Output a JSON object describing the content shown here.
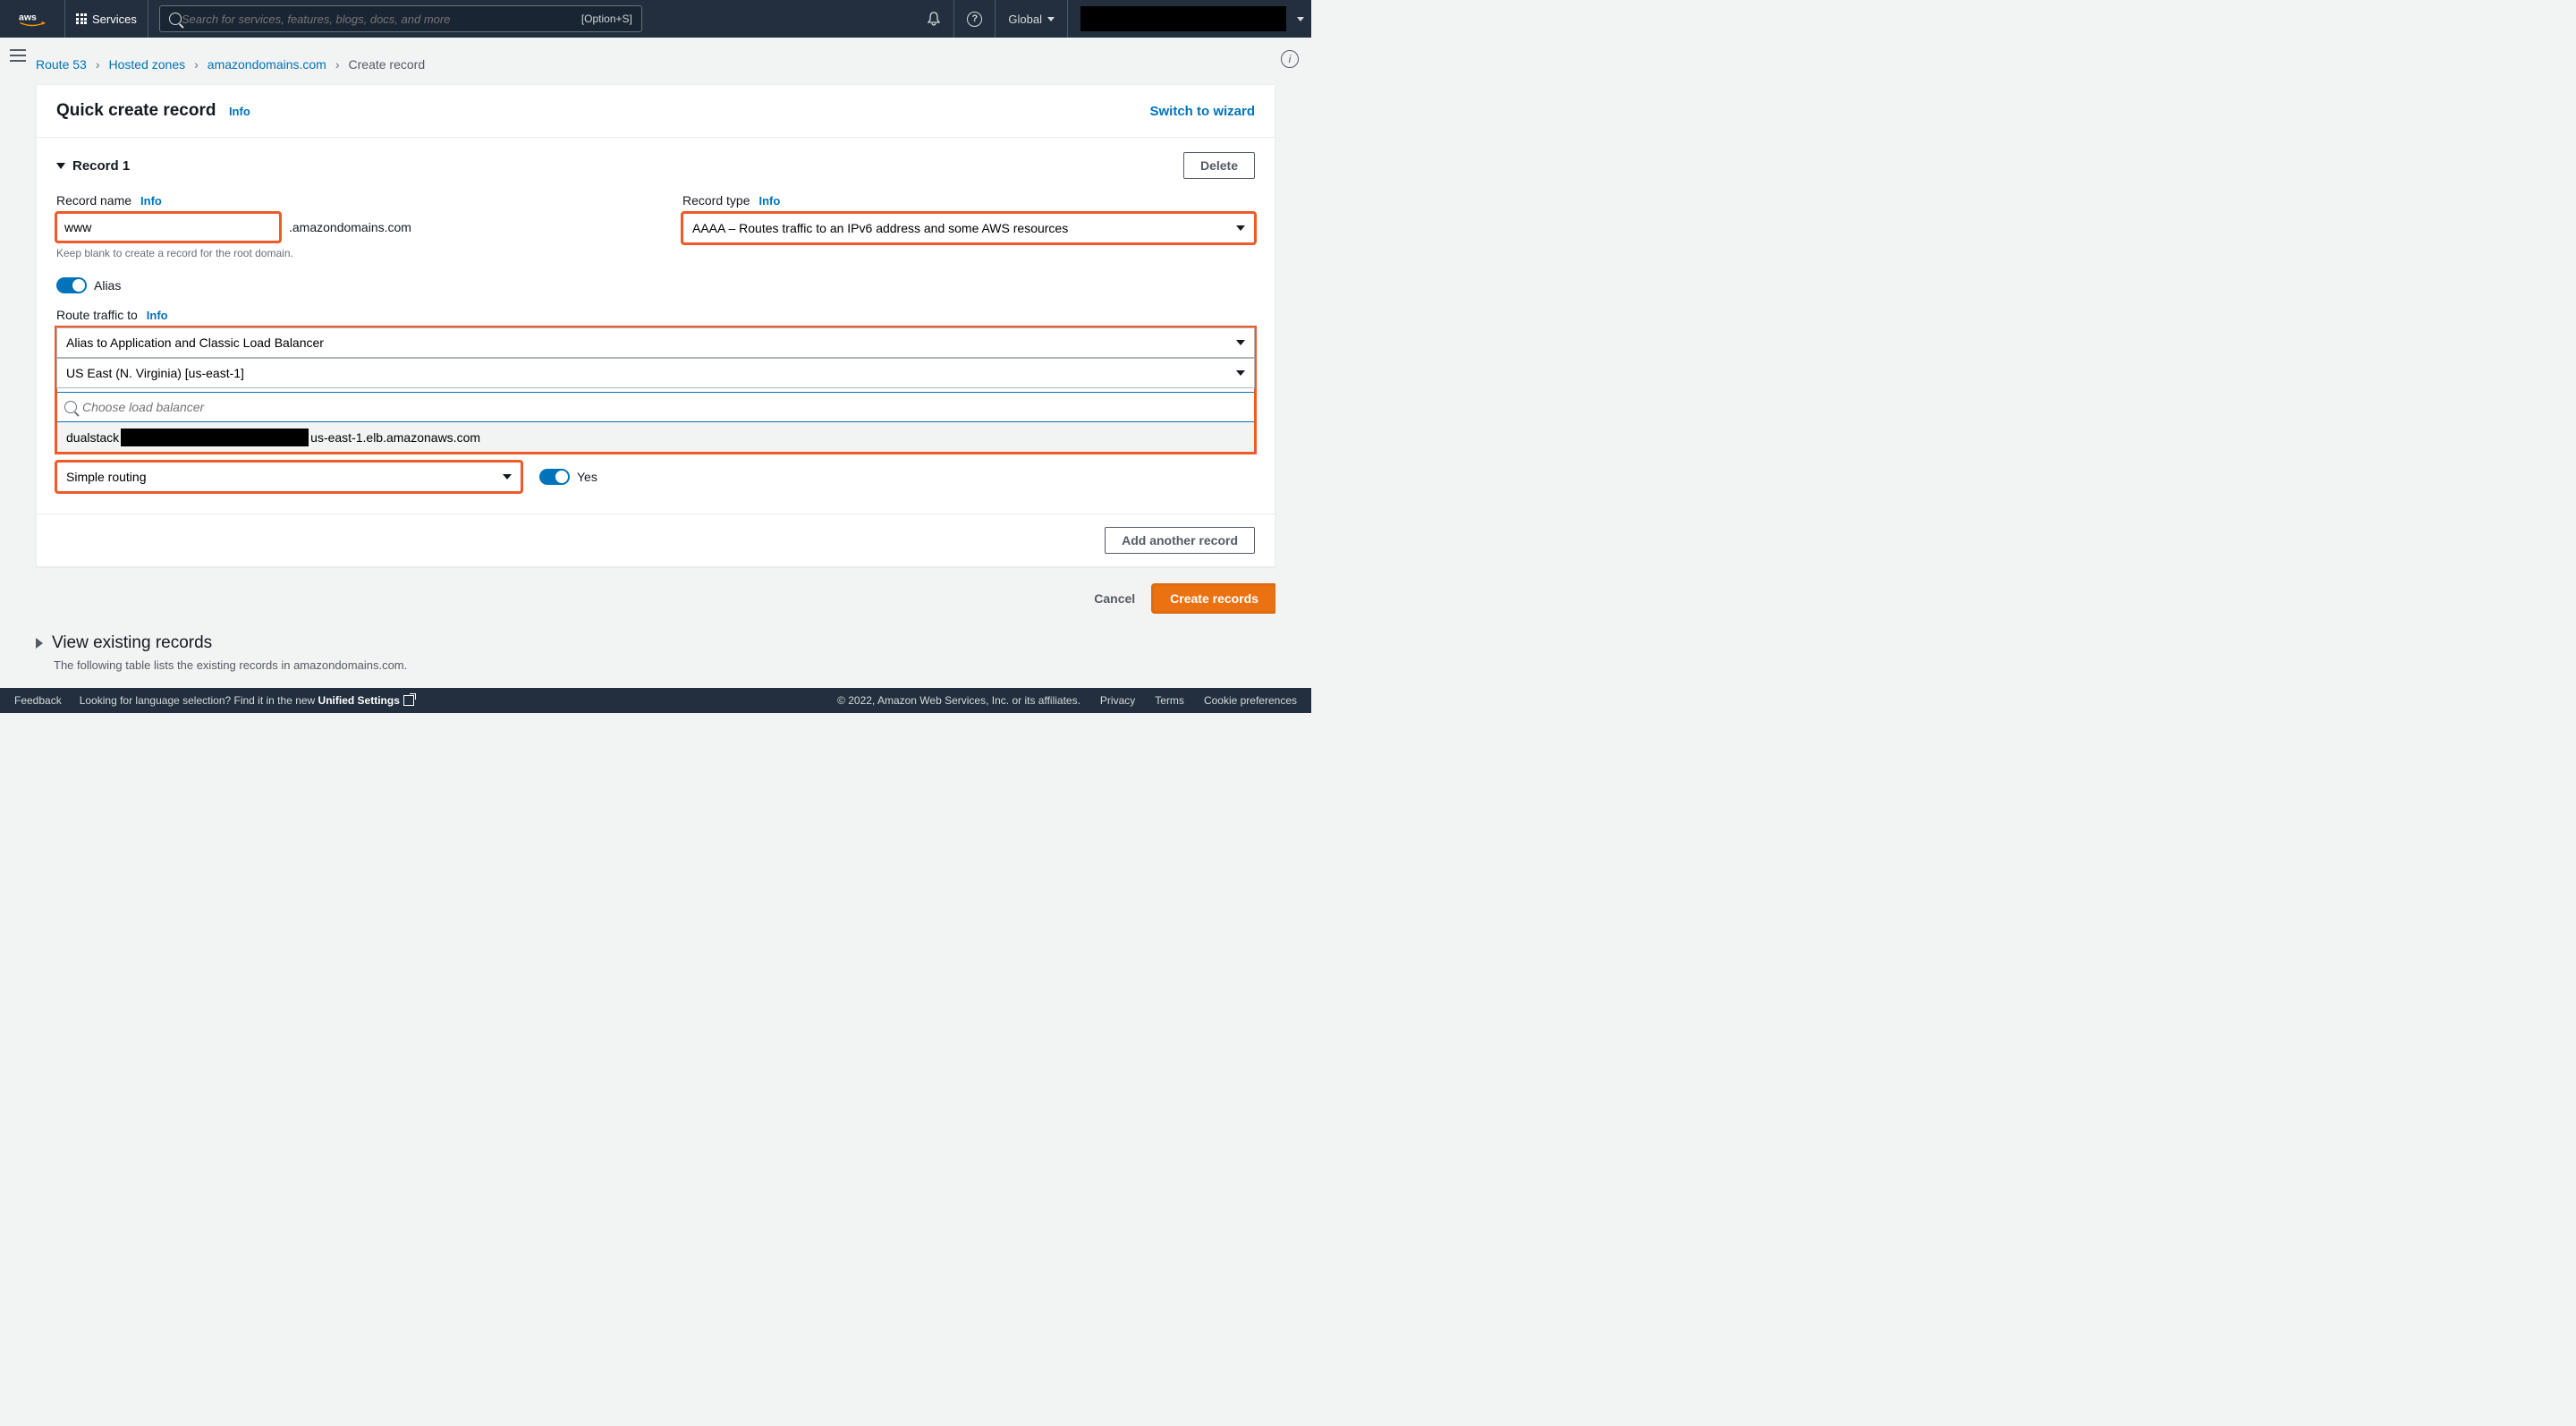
{
  "topnav": {
    "services_label": "Services",
    "search_placeholder": "Search for services, features, blogs, docs, and more",
    "search_shortcut": "[Option+S]",
    "region_label": "Global"
  },
  "breadcrumb": {
    "items": [
      "Route 53",
      "Hosted zones",
      "amazondomains.com"
    ],
    "current": "Create record"
  },
  "panel": {
    "title": "Quick create record",
    "info": "Info",
    "switch": "Switch to wizard"
  },
  "record": {
    "header": "Record 1",
    "delete": "Delete",
    "name_label": "Record name",
    "name_value": "www",
    "name_suffix": ".amazondomains.com",
    "name_hint": "Keep blank to create a record for the root domain.",
    "type_label": "Record type",
    "type_value": "AAAA – Routes traffic to an IPv6 address and some AWS resources",
    "alias_label": "Alias",
    "route_label": "Route traffic to",
    "alias_target": "Alias to Application and Classic Load Balancer",
    "region_value": "US East (N. Virginia) [us-east-1]",
    "lb_placeholder": "Choose load balancer",
    "lb_option_prefix": "dualstack",
    "lb_option_suffix": "us-east-1.elb.amazonaws.com",
    "routing_policy": "Simple routing",
    "health_label": "Yes"
  },
  "footer": {
    "add_another": "Add another record",
    "cancel": "Cancel",
    "create": "Create records"
  },
  "existing": {
    "title": "View existing records",
    "sub": "The following table lists the existing records in amazondomains.com."
  },
  "bottombar": {
    "feedback": "Feedback",
    "lang_prompt": "Looking for language selection? Find it in the new ",
    "unified": "Unified Settings",
    "copyright": "© 2022, Amazon Web Services, Inc. or its affiliates.",
    "privacy": "Privacy",
    "terms": "Terms",
    "cookie": "Cookie preferences"
  }
}
